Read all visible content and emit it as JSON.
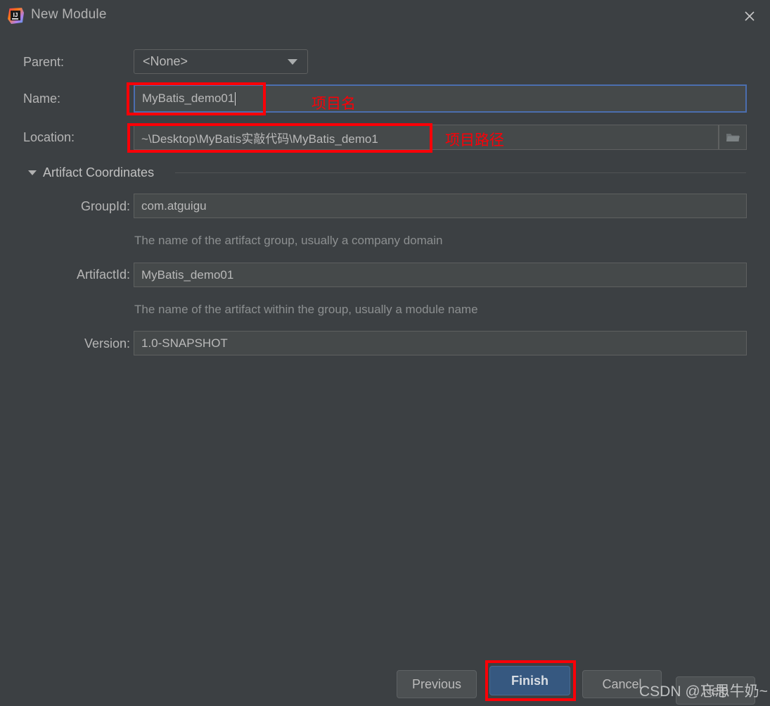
{
  "window": {
    "title": "New Module",
    "app_icon": "intellij-idea-logo",
    "close_icon": "close-icon"
  },
  "form": {
    "parent": {
      "label": "Parent:",
      "value": "<None>",
      "dropdown_icon": "chevron-down-icon"
    },
    "name": {
      "label": "Name:",
      "value": "MyBatis_demo01"
    },
    "location": {
      "label": "Location:",
      "value": "~\\Desktop\\MyBatis实敲代码\\MyBatis_demo1",
      "browse_icon": "folder-icon"
    }
  },
  "artifact_coordinates": {
    "section_label": "Artifact Coordinates",
    "collapse_icon": "triangle-down-icon",
    "group_id": {
      "label": "GroupId:",
      "value": "com.atguigu",
      "hint": "The name of the artifact group, usually a company domain"
    },
    "artifact_id": {
      "label": "ArtifactId:",
      "value": "MyBatis_demo01",
      "hint": "The name of the artifact within the group, usually a module name"
    },
    "version": {
      "label": "Version:",
      "value": "1.0-SNAPSHOT"
    }
  },
  "buttons": {
    "previous": "Previous",
    "finish": "Finish",
    "cancel": "Cancel",
    "help": "Help"
  },
  "annotations": {
    "name_note": "项目名",
    "location_note": "项目路径"
  },
  "watermark": {
    "text": "CSDN @忘思牛奶~"
  },
  "colors": {
    "background": "#3c4043",
    "field_background": "#45494a",
    "accent_blue": "#365880",
    "focus_border": "#4b6eaf",
    "annotation_red": "#fb0007"
  }
}
